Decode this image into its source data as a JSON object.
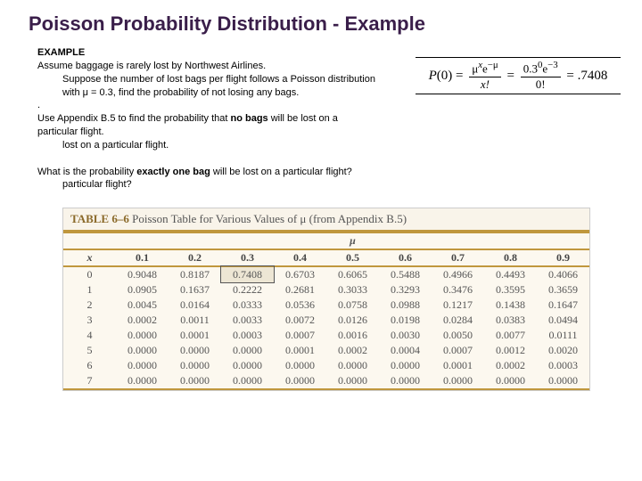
{
  "title": "Poisson Probability Distribution - Example",
  "example_label": "EXAMPLE",
  "body1": "Assume baggage is rarely lost by Northwest Airlines. Suppose the number of lost bags per flight follows a Poisson distribution with μ = 0.3, find the probability of not losing any bags.",
  "body2a": "Use Appendix B.5 to find the probability that ",
  "body2b": "no bags",
  "body2c": " will be lost on a particular flight.",
  "body3a": "What is the probability ",
  "body3b": "exactly one bag",
  "body3c": " will be lost on a particular flight?",
  "formula": {
    "lhs": "P(0) =",
    "num1": "μ<sup>x</sup>e<sup>−μ</sup>",
    "den1": "x!",
    "num2": "0.3<sup>0</sup>e<sup>−3</sup>",
    "den2": "0!",
    "result": "= .7408"
  },
  "table_caption_a": "TABLE 6–6",
  "table_caption_b": "Poisson Table for Various Values of μ (from Appendix B.5)",
  "mu_label": "μ",
  "x_label": "x",
  "chart_data": {
    "type": "table",
    "col_headers": [
      "0.1",
      "0.2",
      "0.3",
      "0.4",
      "0.5",
      "0.6",
      "0.7",
      "0.8",
      "0.9"
    ],
    "row_headers": [
      "0",
      "1",
      "2",
      "3",
      "4",
      "5",
      "6",
      "7"
    ],
    "rows": [
      [
        "0.9048",
        "0.8187",
        "0.7408",
        "0.6703",
        "0.6065",
        "0.5488",
        "0.4966",
        "0.4493",
        "0.4066"
      ],
      [
        "0.0905",
        "0.1637",
        "0.2222",
        "0.2681",
        "0.3033",
        "0.3293",
        "0.3476",
        "0.3595",
        "0.3659"
      ],
      [
        "0.0045",
        "0.0164",
        "0.0333",
        "0.0536",
        "0.0758",
        "0.0988",
        "0.1217",
        "0.1438",
        "0.1647"
      ],
      [
        "0.0002",
        "0.0011",
        "0.0033",
        "0.0072",
        "0.0126",
        "0.0198",
        "0.0284",
        "0.0383",
        "0.0494"
      ],
      [
        "0.0000",
        "0.0001",
        "0.0003",
        "0.0007",
        "0.0016",
        "0.0030",
        "0.0050",
        "0.0077",
        "0.0111"
      ],
      [
        "0.0000",
        "0.0000",
        "0.0000",
        "0.0001",
        "0.0002",
        "0.0004",
        "0.0007",
        "0.0012",
        "0.0020"
      ],
      [
        "0.0000",
        "0.0000",
        "0.0000",
        "0.0000",
        "0.0000",
        "0.0000",
        "0.0001",
        "0.0002",
        "0.0003"
      ],
      [
        "0.0000",
        "0.0000",
        "0.0000",
        "0.0000",
        "0.0000",
        "0.0000",
        "0.0000",
        "0.0000",
        "0.0000"
      ]
    ],
    "highlight": {
      "row": 0,
      "col": 2
    }
  }
}
